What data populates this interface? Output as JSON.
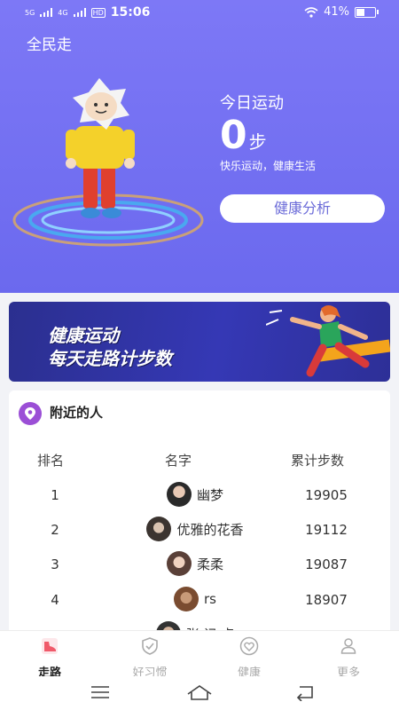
{
  "status": {
    "signal1": "5G",
    "signal2": "4G",
    "hd": "HD",
    "time": "15:06",
    "battery": "41%",
    "battery_level": 0.41
  },
  "hero": {
    "app_title": "全民走",
    "today_label": "今日运动",
    "steps": "0",
    "steps_unit": "步",
    "slogan": "快乐运动，健康生活",
    "analysis_button": "健康分析"
  },
  "banner": {
    "line1": "健康运动",
    "line2": "每天走路计步数"
  },
  "nearby": {
    "title": "附近的人",
    "headers": {
      "rank": "排名",
      "name": "名字",
      "steps": "累计步数"
    },
    "rows": [
      {
        "rank": "1",
        "name": "幽梦",
        "steps": "19905"
      },
      {
        "rank": "2",
        "name": "优雅的花香",
        "steps": "19112"
      },
      {
        "rank": "3",
        "name": "柔柔",
        "steps": "19087"
      },
      {
        "rank": "4",
        "name": "rs",
        "steps": "18907"
      },
      {
        "rank": "",
        "name": "张 记 点",
        "steps": ""
      }
    ]
  },
  "tabs": [
    {
      "label": "走路",
      "icon": "shoe-icon",
      "active": true
    },
    {
      "label": "好习惯",
      "icon": "check-badge-icon",
      "active": false
    },
    {
      "label": "健康",
      "icon": "heart-icon",
      "active": false
    },
    {
      "label": "更多",
      "icon": "person-icon",
      "active": false
    }
  ],
  "colors": {
    "hero": "#7d78f6",
    "button_text": "#6b6bd8",
    "banner": "#3538b5",
    "tab_active_icon": "#f05a6a"
  }
}
